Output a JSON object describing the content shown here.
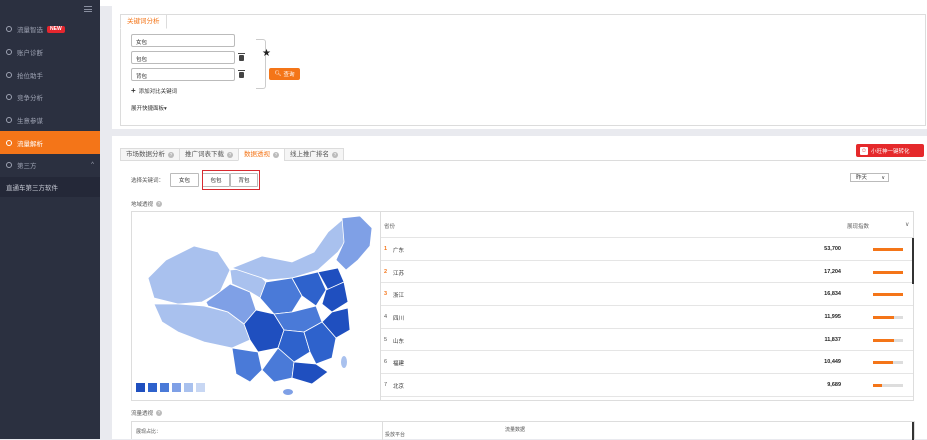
{
  "sidebar": {
    "items": [
      {
        "label": "流量智选",
        "badge": "NEW"
      },
      {
        "label": "账户诊断"
      },
      {
        "label": "抢位助手"
      },
      {
        "label": "竞争分析"
      },
      {
        "label": "生意参谋"
      },
      {
        "label": "流量解析",
        "active": true
      },
      {
        "label": "第三方",
        "chevron": "^"
      }
    ],
    "sub_item": "直通车第三方软件"
  },
  "keyword_section": {
    "tab": "关键词分析",
    "inputs": [
      "女包",
      "包包",
      "背包"
    ],
    "search_label": "查询",
    "add_label": "添加对比关键词",
    "expand_label": "展开快捷面板"
  },
  "analysis": {
    "tabs": [
      {
        "label": "市场数据分析",
        "help": true
      },
      {
        "label": "推广词表下载",
        "help": true
      },
      {
        "label": "数据透视",
        "help": true,
        "active": true
      },
      {
        "label": "线上推广排名",
        "help": true
      }
    ],
    "promo_label": "小旺神一键转化",
    "select_label": "选择关键词：",
    "keyword_buttons": [
      "女包",
      "包包",
      "背包"
    ],
    "date_select": "昨天",
    "region_title": "地域透视",
    "flow_title": "流量透视"
  },
  "region_table": {
    "header_region": "省份",
    "header_metric": "展现指数",
    "rows": [
      {
        "rank": "1",
        "name": "广东",
        "value": "53,700",
        "ratio": 1.0
      },
      {
        "rank": "2",
        "name": "江苏",
        "value": "17,204",
        "ratio": 1.0
      },
      {
        "rank": "3",
        "name": "浙江",
        "value": "16,834",
        "ratio": 1.0
      },
      {
        "rank": "4",
        "name": "四川",
        "value": "11,995",
        "ratio": 0.7
      },
      {
        "rank": "5",
        "name": "山东",
        "value": "11,837",
        "ratio": 0.7
      },
      {
        "rank": "6",
        "name": "福建",
        "value": "10,449",
        "ratio": 0.65
      },
      {
        "rank": "7",
        "name": "北京",
        "value": "9,689",
        "ratio": 0.3
      }
    ]
  },
  "flow_section": {
    "label_share": "展现占比：",
    "label_region": "投放平台",
    "label_data": "流量数据"
  },
  "colors": {
    "accent": "#f47518",
    "sidebar_bg": "#2b3040",
    "map_dark": "#1f4fbf",
    "map_mid": "#4a7ad8",
    "map_light": "#a9c1ee"
  }
}
